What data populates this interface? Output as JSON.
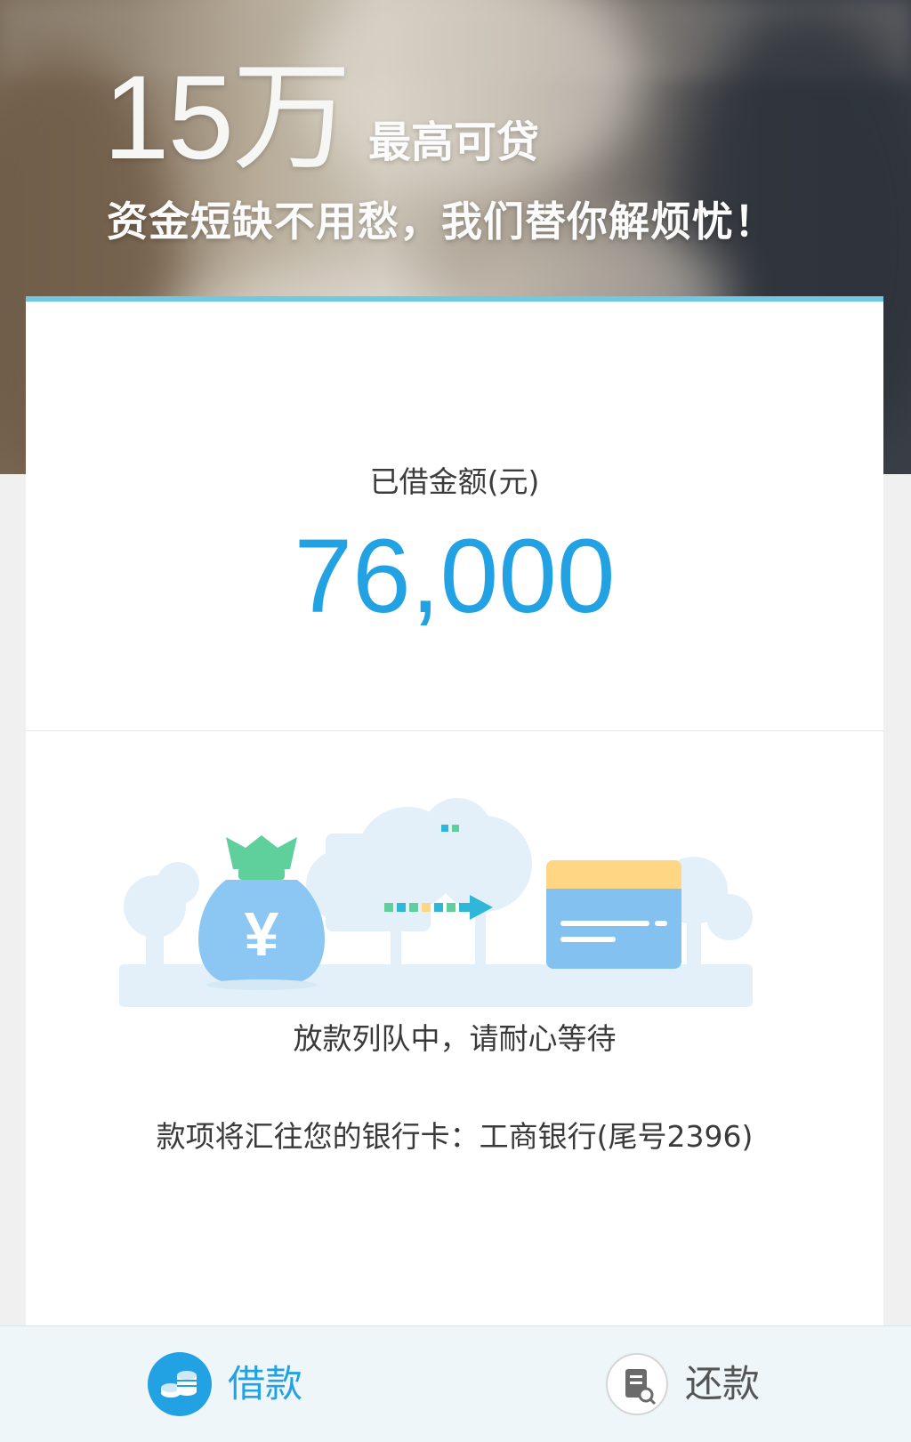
{
  "banner": {
    "amount": "15万",
    "amount_sub": "最高可贷",
    "slogan": "资金短缺不用愁，我们替你解烦忧！"
  },
  "loan": {
    "amount_label": "已借金额(元)",
    "amount_value": "76,000",
    "status": "放款列队中，请耐心等待",
    "bank_info": "款项将汇往您的银行卡：工商银行(尾号2396)",
    "illustration": {
      "money_bag_symbol": "¥",
      "bag_icon": "money-bag-icon",
      "arrow_icon": "arrow-right-icon",
      "card_icon": "bank-card-icon"
    }
  },
  "tabbar": {
    "active_tab": "borrow",
    "tabs": [
      {
        "id": "borrow",
        "label": "借款",
        "icon": "coins-icon"
      },
      {
        "id": "repay",
        "label": "还款",
        "icon": "bill-icon"
      }
    ]
  },
  "colors": {
    "accent": "#22a2e3",
    "card_top_border": "#70c9e3",
    "tabbar_bg": "#eef6f9",
    "page_bg": "#f0f0f0",
    "bag_green": "#5fcf9c",
    "card_yellow": "#ffd684"
  }
}
